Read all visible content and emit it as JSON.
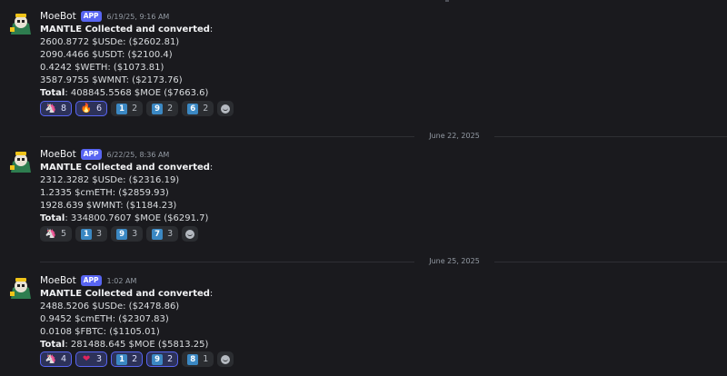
{
  "messages": [
    {
      "username": "MoeBot",
      "badge": "APP",
      "timestamp": "6/19/25, 9:16 AM",
      "heading": "MANTLE Collected and converted",
      "heading_suffix": ":",
      "lines": [
        "2600.8772 $USDe: ($2602.81)",
        "2090.4466 $USDT: ($2100.4)",
        "0.4242 $WETH: ($1073.81)",
        "3587.9755 $WMNT: ($2173.76)"
      ],
      "total_label": "Total",
      "total_value": ": 408845.5568 $MOE ($7663.6)",
      "reactions": [
        {
          "emoji": "unicorn-icon",
          "glyph": "🦄",
          "count": "8",
          "me": true
        },
        {
          "emoji": "fire-icon",
          "glyph": "🔥",
          "count": "6",
          "me": true
        },
        {
          "emoji": "keycap-1-icon",
          "key": "1",
          "count": "2",
          "me": false
        },
        {
          "emoji": "keycap-9-icon",
          "key": "9",
          "count": "2",
          "me": false
        },
        {
          "emoji": "keycap-6-icon",
          "key": "6",
          "count": "2",
          "me": false
        }
      ]
    },
    {
      "username": "MoeBot",
      "badge": "APP",
      "timestamp": "6/22/25, 8:36 AM",
      "heading": "MANTLE Collected and converted",
      "heading_suffix": ":",
      "lines": [
        "2312.3282 $USDe: ($2316.19)",
        "1.2335 $cmETH: ($2859.93)",
        "1928.639 $WMNT: ($1184.23)"
      ],
      "total_label": "Total",
      "total_value": ": 334800.7607 $MOE ($6291.7)",
      "reactions": [
        {
          "emoji": "unicorn-icon",
          "glyph": "🦄",
          "count": "5",
          "me": false
        },
        {
          "emoji": "keycap-1-icon",
          "key": "1",
          "count": "3",
          "me": false
        },
        {
          "emoji": "keycap-9-icon",
          "key": "9",
          "count": "3",
          "me": false
        },
        {
          "emoji": "keycap-7-icon",
          "key": "7",
          "count": "3",
          "me": false
        }
      ]
    },
    {
      "username": "MoeBot",
      "badge": "APP",
      "timestamp": "1:02 AM",
      "heading": "MANTLE Collected and converted",
      "heading_suffix": ":",
      "lines": [
        "2488.5206 $USDe: ($2478.86)",
        "0.9452 $cmETH: ($2307.83)",
        "0.0108 $FBTC: ($1105.01)"
      ],
      "total_label": "Total",
      "total_value": ": 281488.645 $MOE ($5813.25)",
      "reactions": [
        {
          "emoji": "unicorn-icon",
          "glyph": "🦄",
          "count": "4",
          "me": true
        },
        {
          "emoji": "heart-icon",
          "glyph": "❤",
          "count": "3",
          "me": true
        },
        {
          "emoji": "keycap-1-icon",
          "key": "1",
          "count": "2",
          "me": true
        },
        {
          "emoji": "keycap-9-icon",
          "key": "9",
          "count": "2",
          "me": true
        },
        {
          "emoji": "keycap-8-icon",
          "key": "8",
          "count": "1",
          "me": false
        }
      ]
    }
  ],
  "dividers": [
    "June 22, 2025",
    "June 25, 2025"
  ],
  "colors": {
    "background": "#1a1a1e",
    "accent": "#5865f2",
    "keycap": "#3b88c3"
  }
}
